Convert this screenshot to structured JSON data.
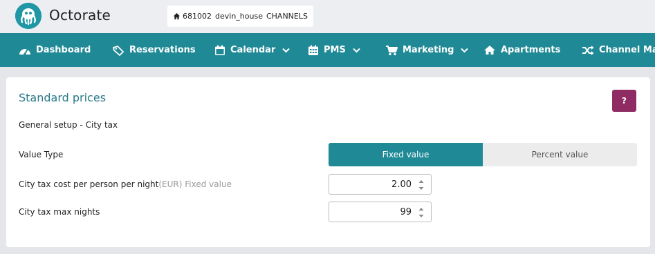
{
  "app": {
    "brand": "Octorate"
  },
  "property": {
    "id": "681002",
    "name": "devin_house",
    "scope": "CHANNELS"
  },
  "nav": [
    {
      "label": "Dashboard",
      "icon": "dashboard-icon",
      "dropdown": false
    },
    {
      "label": "Reservations",
      "icon": "tag-icon",
      "dropdown": false
    },
    {
      "label": "Calendar",
      "icon": "calendar-icon",
      "dropdown": true
    },
    {
      "label": "PMS",
      "icon": "grid-calendar-icon",
      "dropdown": true
    },
    {
      "label": "Marketing",
      "icon": "cart-icon",
      "dropdown": true
    },
    {
      "label": "Apartments",
      "icon": "home-icon",
      "dropdown": false
    },
    {
      "label": "Channel Manag",
      "icon": "shuffle-icon",
      "dropdown": false
    }
  ],
  "page": {
    "title": "Standard prices",
    "help_label": "?",
    "section": "General setup - City tax"
  },
  "form": {
    "value_type": {
      "label": "Value Type",
      "options": [
        "Fixed value",
        "Percent value"
      ],
      "selected": "Fixed value"
    },
    "tax_cost": {
      "label": "City tax cost per person per night",
      "unit": "(EUR)",
      "hint": "Fixed value",
      "value": "2.00"
    },
    "max_nights": {
      "label": "City tax max nights",
      "value": "99"
    }
  },
  "colors": {
    "nav_bg": "#1f8a96",
    "accent": "#1f8a96",
    "title": "#2a7a8a",
    "help_button": "#8e2c63"
  }
}
